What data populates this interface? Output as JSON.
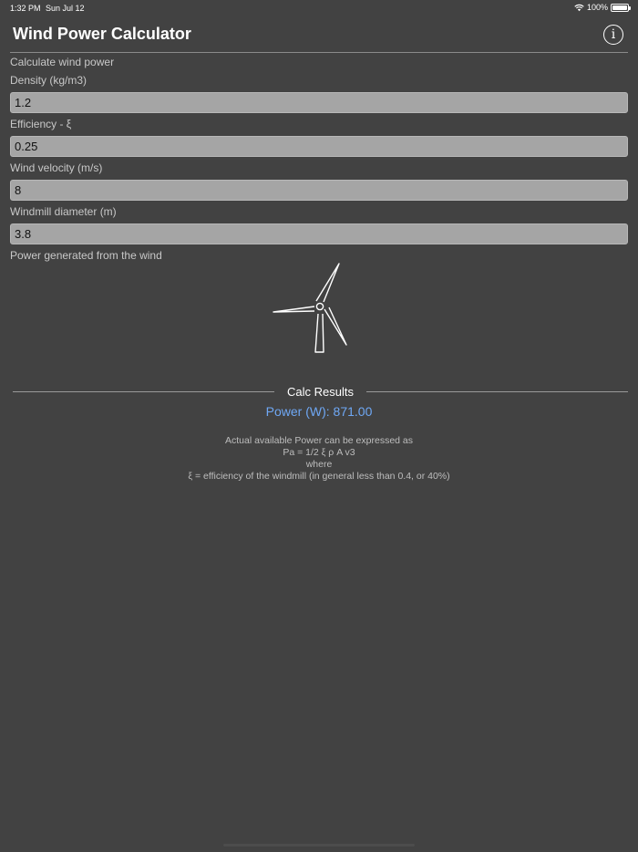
{
  "status_bar": {
    "time": "1:32 PM",
    "date": "Sun Jul 12",
    "battery": "100%",
    "icons": [
      "wifi-icon",
      "battery-icon"
    ]
  },
  "nav": {
    "title": "Wind Power Calculator",
    "info_icon": "info-icon",
    "info_glyph": "i"
  },
  "form": {
    "heading": "Calculate wind power",
    "density": {
      "label": "Density (kg/m3)",
      "value": "1.2"
    },
    "efficiency": {
      "label": "Efficiency - ξ",
      "value": "0.25"
    },
    "velocity": {
      "label": "Wind velocity (m/s)",
      "value": "8"
    },
    "diameter": {
      "label": "Windmill diameter (m)",
      "value": "3.8"
    },
    "power_heading": "Power generated from the wind"
  },
  "illustration": {
    "icon": "wind-turbine-icon"
  },
  "results": {
    "title": "Calc Results",
    "power": "Power (W): 871.00"
  },
  "explanation": {
    "line1": "Actual available Power can be expressed as",
    "line2": "Pa = 1/2 ξ ρ A v3",
    "line3": "where",
    "line4": "ξ = efficiency of the windmill (in general less than 0.4, or 40%)"
  },
  "colors": {
    "background": "#424242",
    "field": "#a5a5a5",
    "accent": "#6fa8f5"
  }
}
